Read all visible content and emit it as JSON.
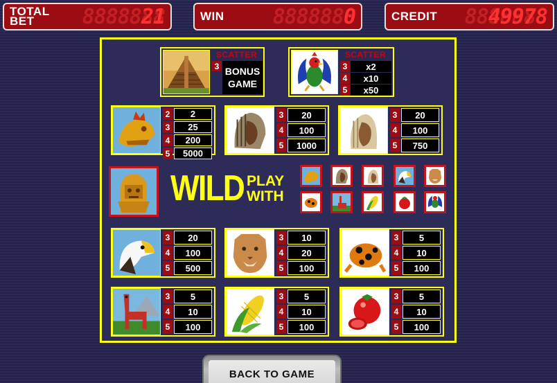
{
  "top_bar": {
    "total_bet": {
      "label": "TOTAL\nBET",
      "ghost": "8888888",
      "value": "21"
    },
    "win": {
      "label": "WIN",
      "ghost": "8888888",
      "value": "0"
    },
    "credit": {
      "label": "CREDIT",
      "ghost": "8888888",
      "value": "49978"
    }
  },
  "scatters": [
    {
      "icon": "pyramid-icon",
      "title": "SCATTER",
      "count": "3",
      "text_line1": "BONUS",
      "text_line2": "GAME"
    },
    {
      "icon": "rooster-icon",
      "title": "SCATTER",
      "rows": [
        {
          "n": "3",
          "v": "x2"
        },
        {
          "n": "4",
          "v": "x10"
        },
        {
          "n": "5",
          "v": "x50"
        }
      ]
    }
  ],
  "high_symbols": [
    {
      "icon": "golden-serpent-head-icon",
      "rows": [
        {
          "n": "2",
          "v": "2"
        },
        {
          "n": "3",
          "v": "25"
        },
        {
          "n": "4",
          "v": "200"
        },
        {
          "n": "5",
          "v": "5000"
        }
      ]
    },
    {
      "icon": "aztec-warrior-icon",
      "rows": [
        {
          "n": "3",
          "v": "20"
        },
        {
          "n": "4",
          "v": "100"
        },
        {
          "n": "5",
          "v": "1000"
        }
      ]
    },
    {
      "icon": "aztec-woman-icon",
      "rows": [
        {
          "n": "3",
          "v": "20"
        },
        {
          "n": "4",
          "v": "100"
        },
        {
          "n": "5",
          "v": "750"
        }
      ]
    }
  ],
  "wild": {
    "icon": "golden-idol-icon",
    "word": "WILD",
    "play_with": "PLAY WITH",
    "substitutes": [
      "golden-serpent-head-icon",
      "aztec-warrior-icon",
      "aztec-woman-icon",
      "eagle-icon",
      "puma-icon",
      "frog-icon",
      "llama-icon",
      "corn-icon",
      "tomato-icon",
      "rooster-icon"
    ]
  },
  "low_symbols": [
    {
      "icon": "eagle-icon",
      "rows": [
        {
          "n": "3",
          "v": "20"
        },
        {
          "n": "4",
          "v": "100"
        },
        {
          "n": "5",
          "v": "500"
        }
      ]
    },
    {
      "icon": "puma-icon",
      "rows": [
        {
          "n": "3",
          "v": "10"
        },
        {
          "n": "4",
          "v": "20"
        },
        {
          "n": "5",
          "v": "100"
        }
      ]
    },
    {
      "icon": "frog-icon",
      "rows": [
        {
          "n": "3",
          "v": "5"
        },
        {
          "n": "4",
          "v": "10"
        },
        {
          "n": "5",
          "v": "100"
        }
      ]
    },
    {
      "icon": "llama-icon",
      "rows": [
        {
          "n": "3",
          "v": "5"
        },
        {
          "n": "4",
          "v": "10"
        },
        {
          "n": "5",
          "v": "100"
        }
      ]
    },
    {
      "icon": "corn-icon",
      "rows": [
        {
          "n": "3",
          "v": "5"
        },
        {
          "n": "4",
          "v": "10"
        },
        {
          "n": "5",
          "v": "100"
        }
      ]
    },
    {
      "icon": "tomato-icon",
      "rows": [
        {
          "n": "3",
          "v": "5"
        },
        {
          "n": "4",
          "v": "10"
        },
        {
          "n": "5",
          "v": "100"
        }
      ]
    }
  ],
  "back_button": {
    "label": "BACK TO GAME"
  },
  "colors": {
    "frame": "#ffff14",
    "led_red": "#9b0d13",
    "background": "#2c2b55"
  }
}
